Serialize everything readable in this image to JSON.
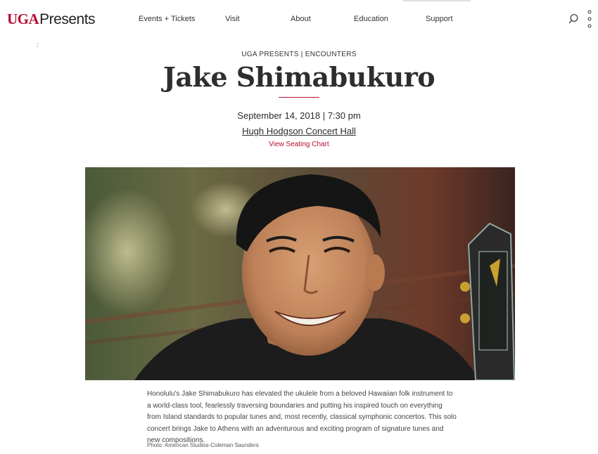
{
  "header": {
    "logo_uga": "UGA",
    "logo_presents": "Presents",
    "nav": [
      "Events + Tickets",
      "Visit",
      "About",
      "Education",
      "Support"
    ],
    "search_icon": "search-icon",
    "menu_icon": "vertical-dots-icon"
  },
  "stray_mark": ":",
  "event": {
    "kicker": "UGA PRESENTS | ENCOUNTERS",
    "title": "Jake Shimabukuro",
    "datetime": "September 14, 2018 | 7:30 pm",
    "venue": "Hugh Hodgson Concert Hall",
    "seating_link": "View Seating Chart"
  },
  "description": "Honolulu's Jake Shimabukuro has elevated the ukulele from a beloved Hawaiian folk instrument to a world-class tool, fearlessly traversing boundaries and putting his inspired touch on everything from Island standards to popular tunes and, most recently, classical symphonic concertos. This solo concert brings Jake to Athens with an adventurous and exciting program of signature tunes and new compositions.",
  "photo_credit": "Photo: American Studios-Coleman Saunders",
  "colors": {
    "brand_red": "#ba0c2f",
    "text": "#2b2b2b"
  }
}
